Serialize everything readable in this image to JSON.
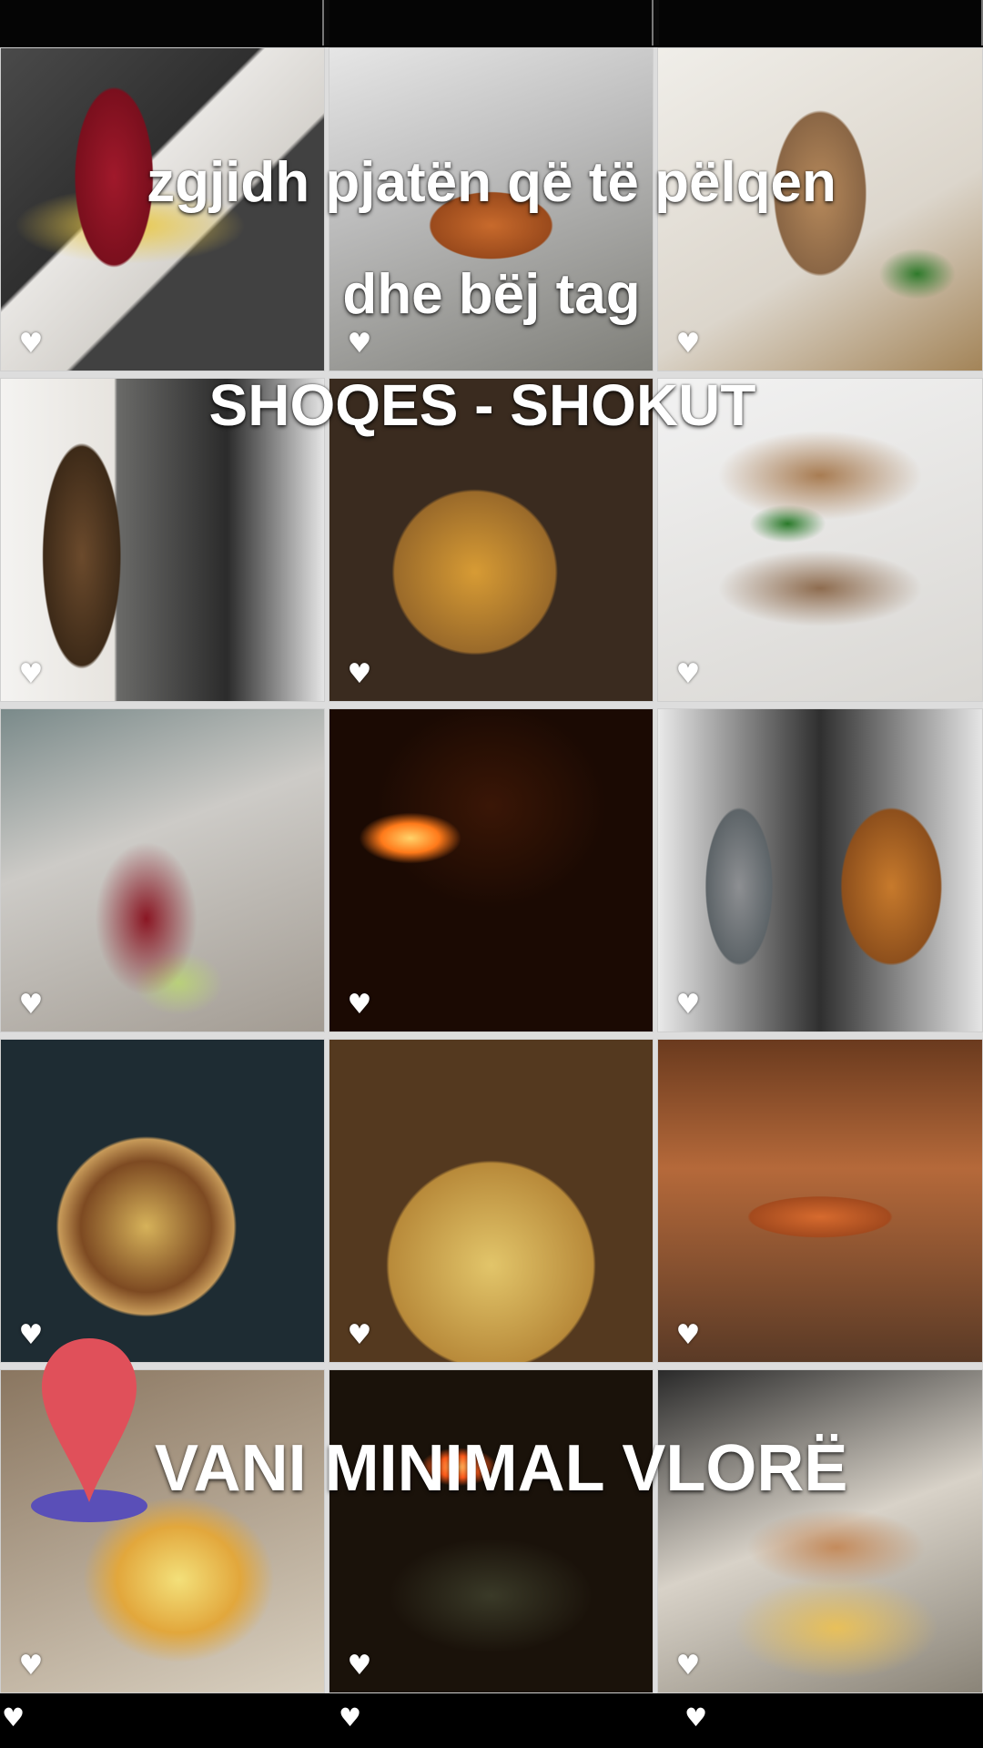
{
  "captions": {
    "line1": "zgjidh pjatën që të pëlqen",
    "line2": "dhe bëj tag",
    "line3": "SHOQES - SHOKUT",
    "location": "VANI MINIMAL VLORË"
  },
  "icons": {
    "like": "heart-icon",
    "location": "location-pin-icon"
  },
  "colors": {
    "pin_red": "#e0505a",
    "pin_base": "#5a4fb8",
    "text": "#ffffff"
  },
  "tiles": [
    {
      "like_glyph": "♥"
    },
    {
      "like_glyph": "♥"
    },
    {
      "like_glyph": "♥"
    },
    {
      "like_glyph": "♥"
    },
    {
      "like_glyph": "♥"
    },
    {
      "like_glyph": "♥"
    },
    {
      "like_glyph": "♥"
    },
    {
      "like_glyph": "♥"
    },
    {
      "like_glyph": "♥"
    },
    {
      "like_glyph": "♥"
    },
    {
      "like_glyph": "♥"
    },
    {
      "like_glyph": "♥"
    },
    {
      "like_glyph": "♥"
    },
    {
      "like_glyph": "♥"
    },
    {
      "like_glyph": "♥"
    }
  ],
  "bottom_hearts": [
    "♥",
    "♥",
    "♥"
  ]
}
